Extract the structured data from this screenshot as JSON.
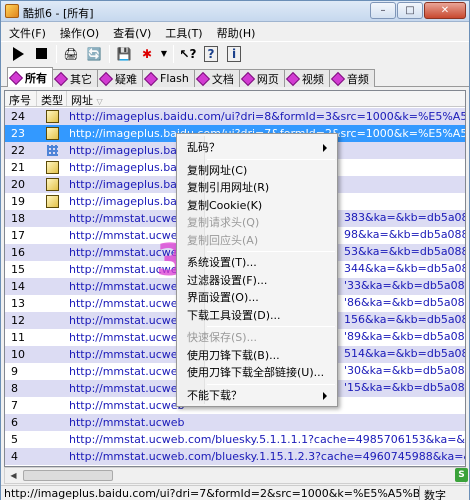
{
  "window": {
    "title": "酷抓6 - [所有]"
  },
  "titlebar_buttons": {
    "minimize": "–",
    "maximize": "□",
    "close": "✕"
  },
  "menubar": [
    {
      "label": "文件(F)"
    },
    {
      "label": "操作(O)"
    },
    {
      "label": "查看(V)"
    },
    {
      "label": "工具(T)"
    },
    {
      "label": "帮助(H)"
    }
  ],
  "tabs": [
    {
      "label": "所有"
    },
    {
      "label": "其它"
    },
    {
      "label": "疑难"
    },
    {
      "label": "Flash"
    },
    {
      "label": "文档"
    },
    {
      "label": "网页"
    },
    {
      "label": "视频"
    },
    {
      "label": "音频"
    }
  ],
  "columns": {
    "num": "序号",
    "type": "类型",
    "url": "网址"
  },
  "rows": [
    {
      "num": "24",
      "icon": "picture-icon",
      "url": "http://imageplus.baidu.com/ui?dri=8&formId=3&src=1000&k=%E5%A5%BD%E7%"
    },
    {
      "num": "23",
      "icon": "picture-icon",
      "url": "http://imageplus.baidu.com/ui?dri=7&formId=2&src=1000&k=%E5%A5%BD%E7%"
    },
    {
      "num": "22",
      "icon": "grid-icon",
      "url": "http://imageplus.ba"
    },
    {
      "num": "21",
      "icon": "picture-icon",
      "url": "http://imageplus.ba"
    },
    {
      "num": "20",
      "icon": "picture-icon",
      "url": "http://imageplus.ba"
    },
    {
      "num": "19",
      "icon": "picture-icon",
      "url": "http://imageplus.ba"
    },
    {
      "num": "18",
      "icon": "",
      "url": "http://mmstat.ucweb",
      "tail": "383&ka=&kb=db5a08"
    },
    {
      "num": "17",
      "icon": "",
      "url": "http://mmstat.ucweb",
      "tail": "98&ka=&kb=db5a088"
    },
    {
      "num": "16",
      "icon": "",
      "url": "http://mmstat.ucweb",
      "tail": "53&ka=&kb=db5a088"
    },
    {
      "num": "15",
      "icon": "",
      "url": "http://mmstat.ucweb",
      "tail": "344&ka=&kb=db5a08"
    },
    {
      "num": "14",
      "icon": "",
      "url": "http://mmstat.ucweb",
      "tail": "'33&ka=&kb=db5a088"
    },
    {
      "num": "13",
      "icon": "",
      "url": "http://mmstat.ucweb",
      "tail": "'86&ka=&kb=db5a088"
    },
    {
      "num": "12",
      "icon": "",
      "url": "http://mmstat.ucweb",
      "tail": "156&ka=&kb=db5a08"
    },
    {
      "num": "11",
      "icon": "",
      "url": "http://mmstat.ucweb",
      "tail": "'89&ka=&kb=db5a088"
    },
    {
      "num": "10",
      "icon": "",
      "url": "http://mmstat.ucweb",
      "tail": "514&ka=&kb=db5a08"
    },
    {
      "num": "9",
      "icon": "",
      "url": "http://mmstat.ucweb",
      "tail": "'30&ka=&kb=db5a088"
    },
    {
      "num": "8",
      "icon": "",
      "url": "http://mmstat.ucweb",
      "tail": "'15&ka=&kb=db5a088"
    },
    {
      "num": "7",
      "icon": "",
      "url": "http://mmstat.ucweb",
      "tail": ""
    },
    {
      "num": "6",
      "icon": "",
      "url": "http://mmstat.ucweb",
      "tail": ""
    },
    {
      "num": "5",
      "icon": "",
      "url": "http://mmstat.ucweb.com/bluesky.5.1.1.1.1?cache=4985706153&ka=&kb=db5a088"
    },
    {
      "num": "4",
      "icon": "",
      "url": "http://mmstat.ucweb.com/bluesky.1.15.1.2.3?cache=4960745988&ka=&kb=db5a08"
    },
    {
      "num": "3",
      "icon": "",
      "url": "http://mmstat.ucweb.com/bluesky.5.1.1.1.1?cache=4984298076&ka=&kb=db5a088"
    },
    {
      "num": "2",
      "icon": "",
      "url": "http://mmstat.ucweb.com/bluesky.1.9.1.1.1?cache=4984238831&ka=&kb=db5a088"
    }
  ],
  "context_menu": {
    "items": [
      {
        "label": "乱码？",
        "disabled": false,
        "submenu": true
      },
      {
        "sep": true
      },
      {
        "label": "复制网址(C)",
        "disabled": false
      },
      {
        "label": "复制引用网址(R)",
        "disabled": false
      },
      {
        "label": "复制Cookie(K)",
        "disabled": false
      },
      {
        "label": "复制请求头(Q)",
        "disabled": true
      },
      {
        "label": "复制回应头(A)",
        "disabled": true
      },
      {
        "sep": true
      },
      {
        "label": "系统设置(T)...",
        "disabled": false
      },
      {
        "label": "过滤器设置(F)...",
        "disabled": false
      },
      {
        "label": "界面设置(O)...",
        "disabled": false
      },
      {
        "label": "下载工具设置(D)...",
        "disabled": false
      },
      {
        "sep": true
      },
      {
        "label": "快速保存(S)...",
        "disabled": true
      },
      {
        "label": "使用刀锋下载(B)...",
        "disabled": false
      },
      {
        "label": "使用刀锋下载全部链接(U)...",
        "disabled": false
      },
      {
        "sep": true
      },
      {
        "label": "不能下载？",
        "disabled": false,
        "submenu": true
      }
    ]
  },
  "watermark": {
    "big": "3322",
    "top": "软件站",
    "cc": ".cc"
  },
  "statusbar": {
    "text": "http://imageplus.baidu.com/ui?dri=7&formId=2&src=1000&k=%E5%A5%BD%E",
    "mode": "数字"
  },
  "colors": {
    "selected_row": "#3399ff",
    "alt_row": "#dcdcf3",
    "url_text": "#1a1ab8",
    "tab_icon": "#d23bd2"
  }
}
